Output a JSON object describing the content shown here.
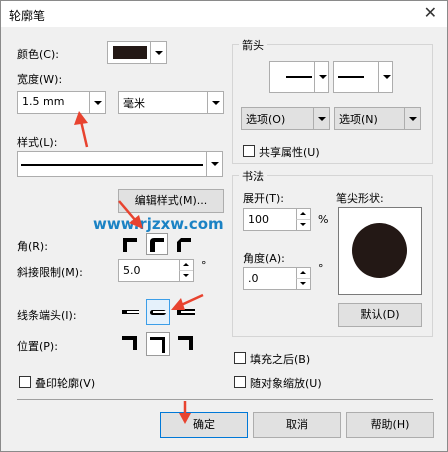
{
  "window": {
    "title": "轮廓笔",
    "close": "✕"
  },
  "color": {
    "label": "颜色(C):",
    "swatch": "#231815"
  },
  "width": {
    "label": "宽度(W):",
    "value": "1.5 mm",
    "unit": "毫米"
  },
  "style": {
    "label": "样式(L):",
    "edit_button": "编辑样式(M)..."
  },
  "watermark": "www.rjzxw.com",
  "corner": {
    "label": "角(R):"
  },
  "miter": {
    "label": "斜接限制(M):",
    "value": "5.0",
    "unit": "°"
  },
  "line_caps": {
    "label": "线条端头(I):"
  },
  "position": {
    "label": "位置(P):"
  },
  "overprint": {
    "label": "叠印轮廓(V)"
  },
  "arrows": {
    "group_title": "箭头",
    "options_left": "选项(O)",
    "options_right": "选项(N)",
    "share_attrs": "共享属性(U)"
  },
  "calligraphy": {
    "group_title": "书法",
    "stretch_label": "展开(T):",
    "stretch_value": "100",
    "stretch_unit": "%",
    "angle_label": "角度(A):",
    "angle_value": ".0",
    "angle_unit": "°",
    "nib_label": "笔尖形状:",
    "default_button": "默认(D)",
    "nib_color": "#231815"
  },
  "fill_behind": {
    "label": "填充之后(B)"
  },
  "scale_with_image": {
    "label": "随对象缩放(U)"
  },
  "footer": {
    "ok": "确定",
    "cancel": "取消",
    "help": "帮助(H)"
  },
  "annotation_color": "#e8432f"
}
